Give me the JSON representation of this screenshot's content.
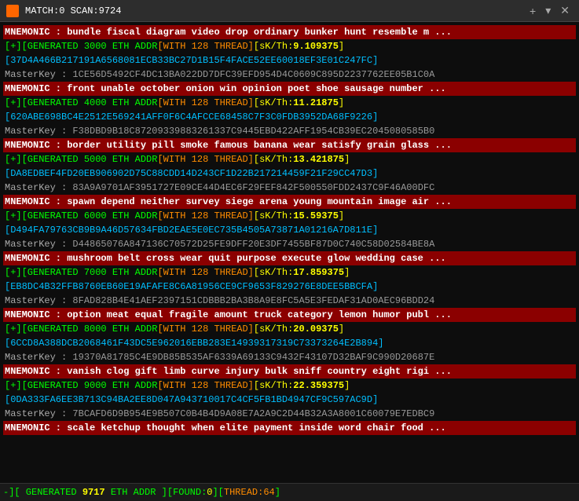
{
  "titleBar": {
    "icon": "app-icon",
    "title": "MATCH:0 SCAN:9724",
    "plusBtn": "+",
    "dropdownBtn": "▾",
    "closeBtn": "✕"
  },
  "lines": [
    {
      "type": "mnemonic",
      "text": "MNEMONIC : bundle fiscal diagram video drop ordinary bunker hunt resemble m ..."
    },
    {
      "type": "generated",
      "num": "3000",
      "addr": "ETH ADDR",
      "with": "128",
      "thread": "THREAD",
      "sk": "9.109375"
    },
    {
      "type": "addr",
      "text": "37D4A466B217191A6568081ECB33BC27D1B15F4FACE52EE60018EF3E01C247FC"
    },
    {
      "type": "masterkey",
      "label": "MasterKey",
      "value": "1CE56D5492CF4DC13BA022DD7DFC39EFD954D4C0609C895D2237762EE05B1C0A"
    },
    {
      "type": "mnemonic",
      "text": "MNEMONIC : front unable october onion win opinion poet shoe sausage number ..."
    },
    {
      "type": "generated",
      "num": "4000",
      "addr": "ETH ADDR",
      "with": "128",
      "thread": "THREAD",
      "sk": "11.21875"
    },
    {
      "type": "addr",
      "text": "620ABE698BC4E2512E569241AFF0F6C4AFCCE68458C7F3C0FDB3952DA68F9226"
    },
    {
      "type": "masterkey",
      "label": "MasterKey",
      "value": "F38DBD9B18C87209339883261337C9445EBD422AFF1954CB39EC2045080585B0"
    },
    {
      "type": "mnemonic",
      "text": "MNEMONIC : border utility pill smoke famous banana wear satisfy grain glass ..."
    },
    {
      "type": "generated",
      "num": "5000",
      "addr": "ETH ADDR",
      "with": "128",
      "thread": "THREAD",
      "sk": "13.421875"
    },
    {
      "type": "addr",
      "text": "DA8EDBEF4FD20EB906902D75C88CDD14D243CF1D22B217214459F21F29CC47D3"
    },
    {
      "type": "masterkey",
      "label": "MasterKey",
      "value": "83A9A9701AF3951727E09CE44D4EC6F29FEF842F500550FDD2437C9F46A00DFC"
    },
    {
      "type": "mnemonic",
      "text": "MNEMONIC : spawn depend neither survey siege arena young mountain image air ..."
    },
    {
      "type": "generated",
      "num": "6000",
      "addr": "ETH ADDR",
      "with": "128",
      "thread": "THREAD",
      "sk": "15.59375"
    },
    {
      "type": "addr",
      "text": "D494FA79763CB9B9A46D57634FBD2EAE5E0EC735B4505A73871A01216A7D811E"
    },
    {
      "type": "masterkey",
      "label": "MasterKey",
      "value": "D44865076A847136C70572D25FE9DFF20E3DF7455BF87D0C740C58D02584BE8A"
    },
    {
      "type": "mnemonic",
      "text": "MNEMONIC : mushroom belt cross wear quit purpose execute glow wedding case ..."
    },
    {
      "type": "generated",
      "num": "7000",
      "addr": "ETH ADDR",
      "with": "128",
      "thread": "THREAD",
      "sk": "17.859375"
    },
    {
      "type": "addr",
      "text": "EB8DC4B32FFB8760EB60E19AFAFE8C6A81956CE9CF9653F829276E8DEE5BBCFA"
    },
    {
      "type": "masterkey",
      "label": "MasterKey",
      "value": "8FAD828B4E41AEF2397151CDBBB2BA3B8A9E8FC5A5E3FEDAF31AD0AEC96BDD24"
    },
    {
      "type": "mnemonic",
      "text": "MNEMONIC : option meat equal fragile amount truck category lemon humor publ ..."
    },
    {
      "type": "generated",
      "num": "8000",
      "addr": "ETH ADDR",
      "with": "128",
      "thread": "THREAD",
      "sk": "20.09375"
    },
    {
      "type": "addr",
      "text": "6CCD8A388DCB2068461F43DC5E962016EBB283E14939317319C73373264E2B894"
    },
    {
      "type": "masterkey",
      "label": "MasterKey",
      "value": "19370A81785C4E9DB85B535AF6339A69133C9432F43107D32BAF9C990D20687E"
    },
    {
      "type": "mnemonic",
      "text": "MNEMONIC : vanish clog gift limb curve injury bulk sniff country eight rigi ..."
    },
    {
      "type": "generated",
      "num": "9000",
      "addr": "ETH ADDR",
      "with": "128",
      "thread": "THREAD",
      "sk": "22.359375"
    },
    {
      "type": "addr",
      "text": "0DA333FA6EE3B713C94BA2EE8D047A943710017C4CF5FB1BD4947CF9C597AC9D"
    },
    {
      "type": "masterkey",
      "label": "MasterKey",
      "value": "7BCAFD6D9B954E9B507C0B4B4D9A08E7A2A9C2D44B32A3A8001C60079E7EDBC9"
    },
    {
      "type": "mnemonic",
      "text": "MNEMONIC : scale ketchup thought when elite payment inside word chair food ..."
    }
  ],
  "bottomBar": {
    "prefix": "-][",
    "generated": "GENERATED",
    "scan": "9717",
    "eth": "ETH ADDR",
    "found_label": "FOUND:",
    "found_val": "0",
    "thread_label": "THREAD:",
    "thread_val": "64"
  }
}
